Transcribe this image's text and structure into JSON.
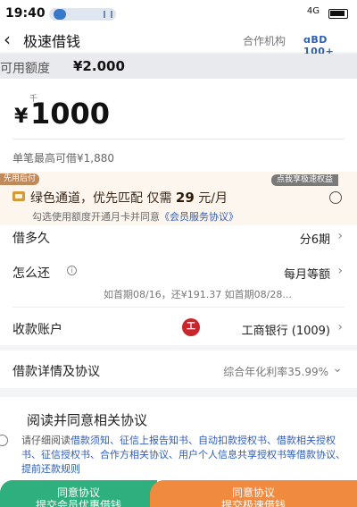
{
  "status_bar": {
    "time": "19:40",
    "network": "4G"
  },
  "header": {
    "back_icon": "chevron-left-icon",
    "title": "极速借钱",
    "partner_label": "合作机构",
    "partner_logo": "ɑBD 100+"
  },
  "available": {
    "label": "可用额度",
    "value": "¥2.000"
  },
  "amount": {
    "unit": "千",
    "currency": "¥",
    "value": "1000",
    "max_note": "单笔最高可借¥1,880"
  },
  "promo": {
    "tag": "先用后付",
    "badge": "点我享极速权益",
    "title_prefix": "绿色通道，优先匹配 仅需",
    "title_price": "29",
    "title_suffix": "元/月",
    "note": "勾选使用额度开通月卡并同意",
    "note_link": "《会员服务协议》"
  },
  "rows": {
    "term_label": "借多久",
    "term_value": "分6期",
    "repay_label": "怎么还",
    "repay_value": "每月等额",
    "repay_sub": "如首期08/16，还¥191.37  如首期08/28...",
    "account_label": "收款账户",
    "account_value": "工商银行 (1009)",
    "bank_icon": "工"
  },
  "details": {
    "label": "借款详情及协议",
    "value": "综合年化利率35.99%"
  },
  "agreement": {
    "title": "阅读并同意相关协议",
    "prefix": "请仔细阅读",
    "links": "借款须知、征信上报告知书、自动扣款授权书、借款相关授权书、征信授权书、合作方相关协议、用户个人信息共享授权书等借款协议、提前还款规则"
  },
  "buttons": {
    "left_line1": "同意协议",
    "left_line2": "提交会员优惠借钱",
    "right_line1": "同意协议",
    "right_line2": "提交极速借钱"
  },
  "colors": {
    "primary_green": "#2fae7e",
    "primary_orange": "#f08a3e",
    "link_blue": "#2f5db5",
    "bank_red": "#c9252c"
  }
}
